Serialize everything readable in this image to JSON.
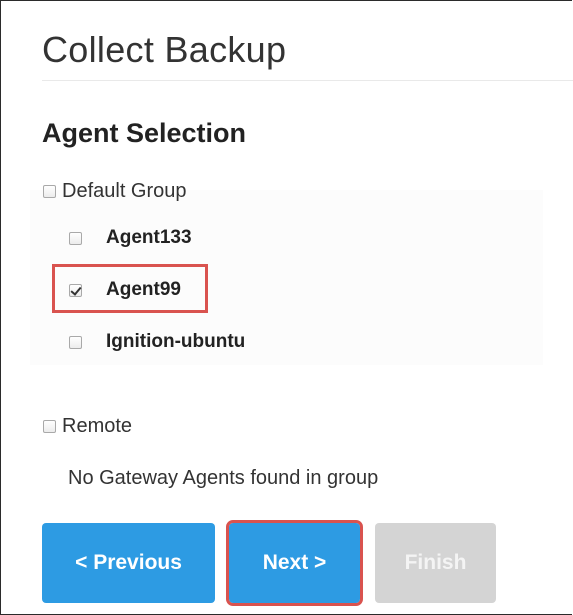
{
  "header": {
    "title": "Collect Backup"
  },
  "agent_selection": {
    "heading": "Agent Selection",
    "groups": [
      {
        "label": "Default Group",
        "checked": false,
        "agents": [
          {
            "label": "Agent133",
            "checked": false
          },
          {
            "label": "Agent99",
            "checked": true
          },
          {
            "label": "Ignition-ubuntu",
            "checked": false
          }
        ]
      },
      {
        "label": "Remote",
        "checked": false,
        "empty_message": "No Gateway Agents found in group"
      }
    ]
  },
  "footer": {
    "previous_label": "< Previous",
    "next_label": "Next >",
    "finish_label": "Finish",
    "finish_disabled": true
  },
  "colors": {
    "primary_button": "#2d9be3",
    "disabled_button": "#d4d4d4",
    "highlight": "#d9534f"
  }
}
